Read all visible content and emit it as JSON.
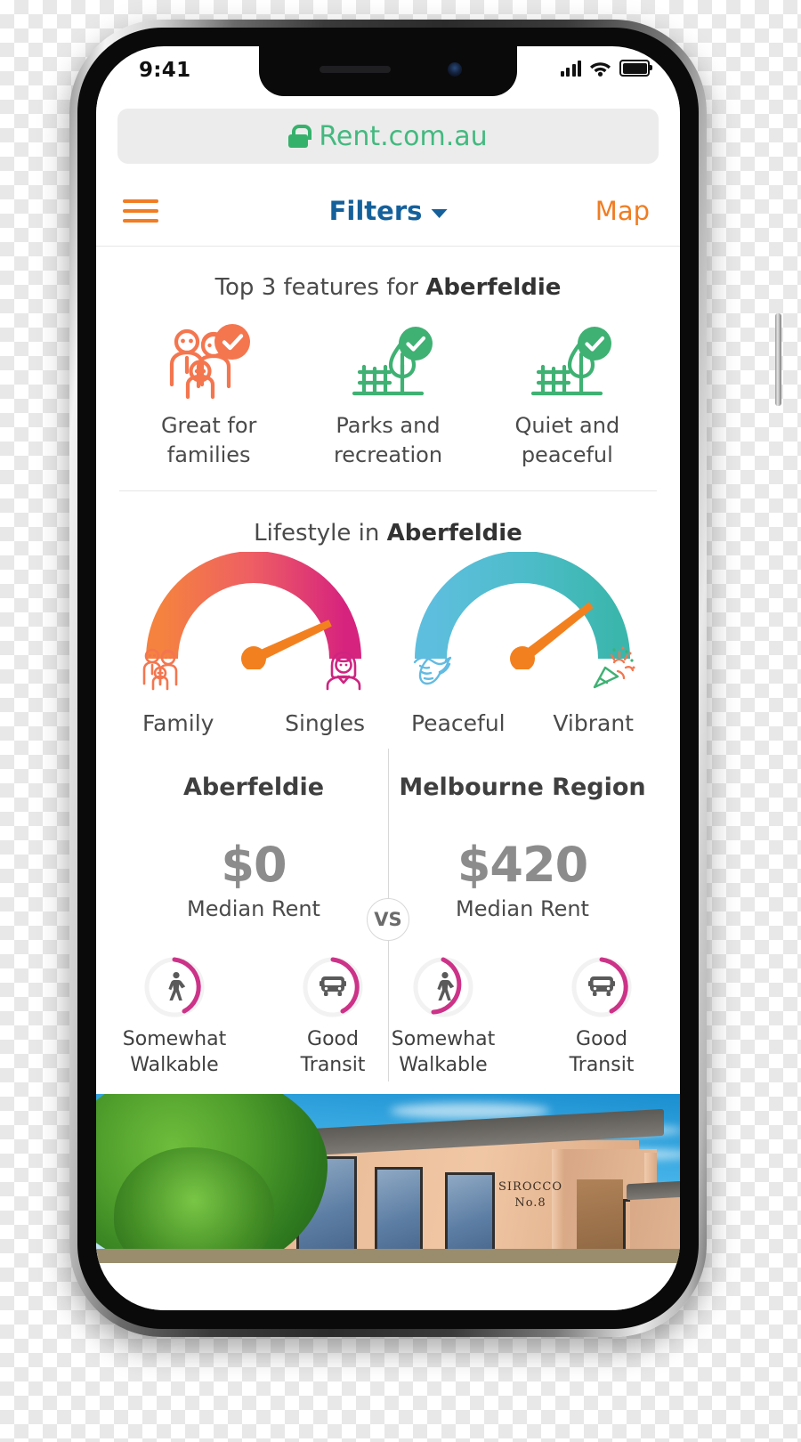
{
  "status_bar": {
    "time": "9:41",
    "signal_icon": "cellular-signal-icon",
    "wifi_icon": "wifi-icon",
    "battery_icon": "battery-icon"
  },
  "browser": {
    "lock_icon": "lock-icon",
    "url": "Rent.com.au"
  },
  "app_nav": {
    "menu_icon": "hamburger-menu-icon",
    "filters_label": "Filters",
    "filters_caret_icon": "chevron-down-icon",
    "map_label": "Map"
  },
  "suburb": "Aberfeldie",
  "top_features": {
    "title_prefix": "Top 3 features for ",
    "title_suburb": "Aberfeldie",
    "items": [
      {
        "icon": "family-check-icon",
        "label": "Great for\nfamilies",
        "line1": "Great for",
        "line2": "families",
        "color": "#F4764F"
      },
      {
        "icon": "park-bench-tree-check-icon",
        "label": "Parks and\nrecreation",
        "line1": "Parks and",
        "line2": "recreation",
        "color": "#3FB173"
      },
      {
        "icon": "park-bench-tree-check-icon",
        "label": "Quiet and\npeaceful",
        "line1": "Quiet and",
        "line2": "peaceful",
        "color": "#3FB173"
      }
    ]
  },
  "lifestyle": {
    "title_prefix": "Lifestyle in ",
    "title_suburb": "Aberfeldie",
    "gauges": [
      {
        "name": "family-singles-gauge",
        "left_label": "Family",
        "right_label": "Singles",
        "left_icon": "family-icon",
        "right_icon": "single-person-icon",
        "needle_value": 0.14,
        "start_color": "#F5823F",
        "end_color": "#D6237E",
        "needle_color": "#F3801F"
      },
      {
        "name": "peaceful-vibrant-gauge",
        "left_label": "Peaceful",
        "right_label": "Vibrant",
        "left_icon": "dove-icon",
        "right_icon": "party-popper-icon",
        "needle_value": 0.22,
        "start_color": "#5EBEDE",
        "end_color": "#3BB6AD",
        "needle_color": "#F3801F"
      }
    ]
  },
  "comparison": {
    "vs_label": "VS",
    "columns": [
      {
        "name": "Aberfeldie",
        "price": "$0",
        "price_caption": "Median Rent",
        "scores": [
          {
            "icon": "walk-icon",
            "line1": "Somewhat",
            "line2": "Walkable",
            "percent": 38,
            "color": "#CC3388"
          },
          {
            "icon": "bus-icon",
            "line1": "Good",
            "line2": "Transit",
            "percent": 38,
            "color": "#CC3388"
          }
        ]
      },
      {
        "name": "Melbourne Region",
        "price": "$420",
        "price_caption": "Median Rent",
        "scores": [
          {
            "icon": "walk-icon",
            "line1": "Somewhat",
            "line2": "Walkable",
            "percent": 45,
            "color": "#CC3388"
          },
          {
            "icon": "bus-icon",
            "line1": "Good",
            "line2": "Transit",
            "percent": 38,
            "color": "#CC3388"
          }
        ]
      }
    ]
  },
  "listing_photo": {
    "name": "property-photo",
    "sign_line1": "SIROCCO",
    "sign_line2": "No.8"
  },
  "colors": {
    "brand_orange": "#F07D23",
    "link_blue": "#15609B",
    "url_green": "#43B97F",
    "magenta": "#CC3388",
    "grey_text": "#4A4A4A"
  }
}
